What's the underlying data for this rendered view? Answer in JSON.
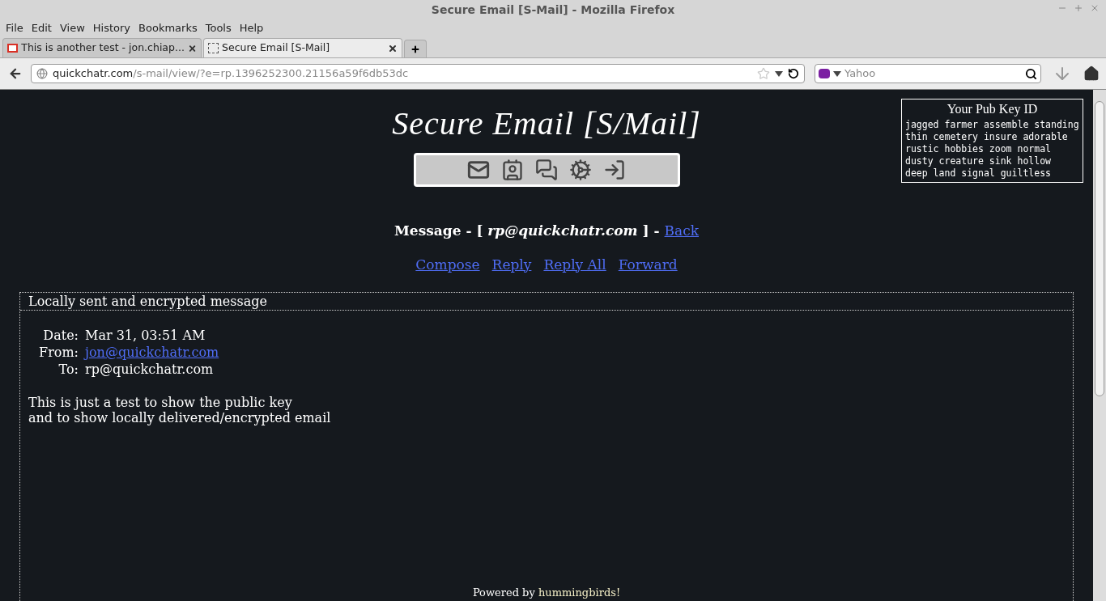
{
  "window": {
    "title": "Secure Email [S-Mail] - Mozilla Firefox"
  },
  "menu": [
    "File",
    "Edit",
    "View",
    "History",
    "Bookmarks",
    "Tools",
    "Help"
  ],
  "tabs": [
    {
      "label": "This is another test - jon.chiap...",
      "selected": false,
      "kind": "gmail"
    },
    {
      "label": "Secure Email [S-Mail]",
      "selected": true,
      "kind": "blank"
    }
  ],
  "address": {
    "host": "quickchatr.com",
    "path": "/s-mail/view/?e=rp.1396252300.21156a59f6db53dc"
  },
  "search": {
    "placeholder": "Yahoo"
  },
  "page": {
    "logo": "Secure Email [S/Mail]",
    "pub_key": {
      "title": "Your Pub Key ID",
      "lines": [
        "jagged farmer assemble standing",
        "thin cemetery insure adorable",
        "rustic hobbies zoom normal",
        "dusty creature sink hollow",
        "deep land signal guiltless"
      ]
    },
    "heading": "Message - [ *rp@quickchatr.com* ] -",
    "back": "Back",
    "actions": [
      "Compose",
      "Reply",
      "Reply All",
      "Forward"
    ],
    "message": {
      "title": "Locally sent and encrypted message",
      "fields": [
        {
          "label": "Date:",
          "value": "Mar 31, 03:51 AM",
          "kind": "text"
        },
        {
          "label": "From:",
          "value": "jon@quickchatr.com",
          "kind": "link"
        },
        {
          "label": "To:",
          "value": "rp@quickchatr.com",
          "kind": "text"
        }
      ],
      "body": [
        "This is just a test to show the public key",
        "and to show locally delivered/encrypted email"
      ]
    },
    "footer": {
      "text": "Powered by",
      "link": "hummingbirds!"
    }
  }
}
